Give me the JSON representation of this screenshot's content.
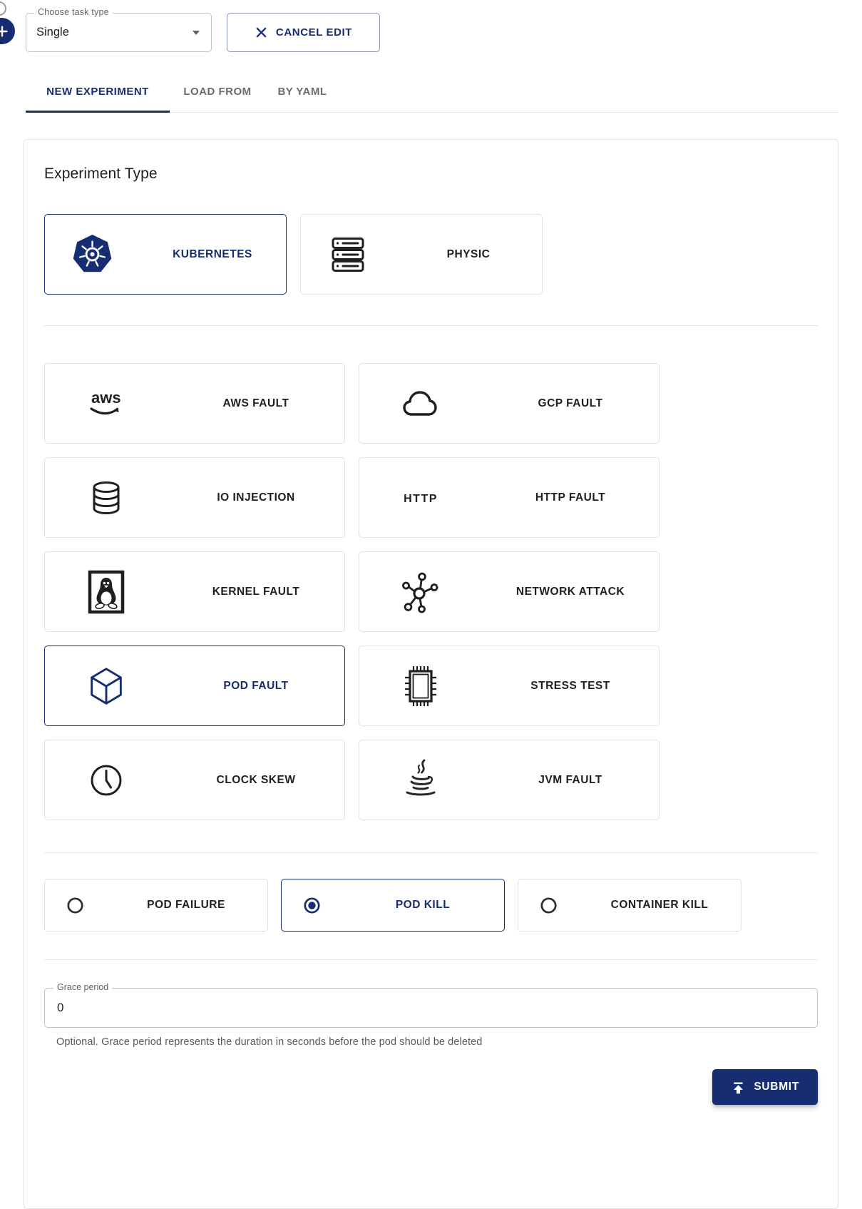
{
  "colors": {
    "primary": "#172d72",
    "border": "#e0e0e0",
    "text_primary": "#1f1f1f",
    "text_secondary": "#636363"
  },
  "header": {
    "fab_icon": "plus-icon",
    "task_type": {
      "label": "Choose task type",
      "value": "Single",
      "icon": "chevron-down-icon"
    },
    "cancel_edit": {
      "label": "CANCEL EDIT",
      "icon": "close-icon"
    }
  },
  "tabs": [
    {
      "label": "NEW EXPERIMENT",
      "active": true
    },
    {
      "label": "LOAD FROM",
      "active": false
    },
    {
      "label": "BY YAML",
      "active": false
    }
  ],
  "experiment": {
    "heading": "Experiment Type",
    "platforms": [
      {
        "label": "KUBERNETES",
        "icon": "kubernetes-icon",
        "selected": true
      },
      {
        "label": "PHYSIC",
        "icon": "server-icon",
        "selected": false
      }
    ],
    "kinds": [
      {
        "label": "AWS FAULT",
        "icon": "aws-icon",
        "selected": false
      },
      {
        "label": "GCP FAULT",
        "icon": "cloud-icon",
        "selected": false
      },
      {
        "label": "IO INJECTION",
        "icon": "database-icon",
        "selected": false
      },
      {
        "label": "HTTP FAULT",
        "icon": "http-text-icon",
        "selected": false
      },
      {
        "label": "KERNEL FAULT",
        "icon": "linux-tux-icon",
        "selected": false
      },
      {
        "label": "NETWORK ATTACK",
        "icon": "network-nodes-icon",
        "selected": false
      },
      {
        "label": "POD FAULT",
        "icon": "cube-icon",
        "selected": true
      },
      {
        "label": "STRESS TEST",
        "icon": "cpu-chip-icon",
        "selected": false
      },
      {
        "label": "CLOCK SKEW",
        "icon": "clock-icon",
        "selected": false
      },
      {
        "label": "JVM FAULT",
        "icon": "java-cup-icon",
        "selected": false
      }
    ],
    "kind_icon_texts": {
      "aws": "aws",
      "http": "HTTP"
    },
    "actions": [
      {
        "label": "POD FAILURE",
        "selected": false
      },
      {
        "label": "POD KILL",
        "selected": true
      },
      {
        "label": "CONTAINER KILL",
        "selected": false
      }
    ],
    "grace_period": {
      "label": "Grace period",
      "value": "0",
      "helper_text": "Optional. Grace period represents the duration in seconds before the pod should be deleted"
    },
    "submit": {
      "label": "SUBMIT",
      "icon": "publish-icon"
    }
  }
}
